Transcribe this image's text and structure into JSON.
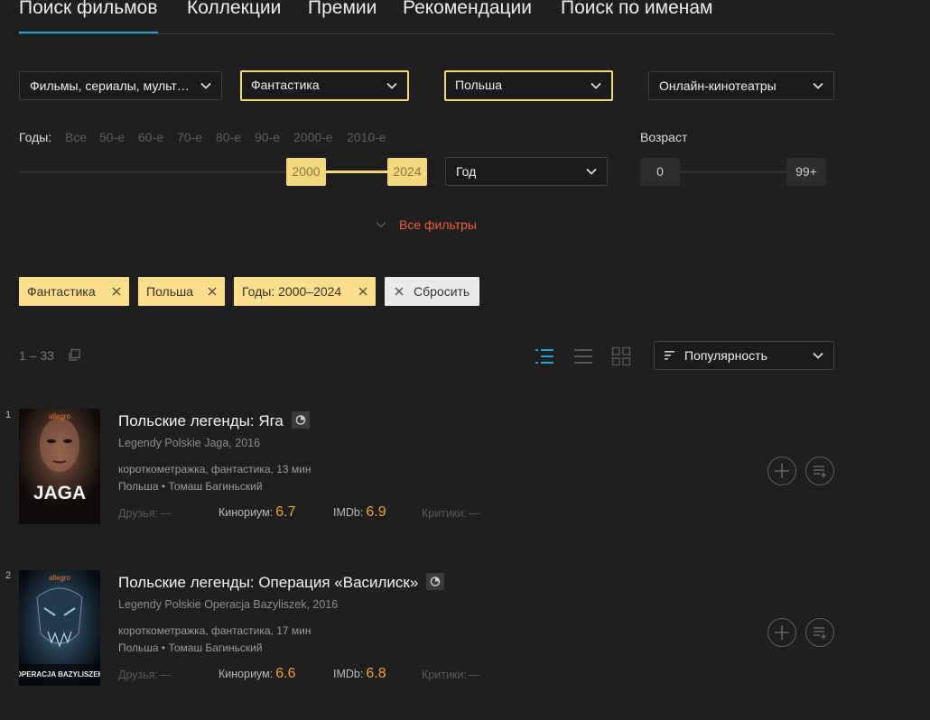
{
  "tabs": [
    {
      "label": "Поиск фильмов",
      "active": true
    },
    {
      "label": "Коллекции"
    },
    {
      "label": "Премии"
    },
    {
      "label": "Рекомендации"
    },
    {
      "label": "Поиск по именам"
    }
  ],
  "filters": {
    "type": "Фильмы, сериалы, мульт…",
    "genre": "Фантастика",
    "country": "Польша",
    "online": "Онлайн-кинотеатры",
    "sort_year": "Год"
  },
  "years": {
    "label": "Годы:",
    "presets": [
      "Все",
      "50-е",
      "60-е",
      "70-е",
      "80-е",
      "90-е",
      "2000-е",
      "2010-е"
    ],
    "from": "2000",
    "to": "2024"
  },
  "age": {
    "label": "Возраст",
    "min": "0",
    "max": "99+"
  },
  "all_filters_label": "Все фильтры",
  "chips": [
    {
      "label": "Фантастика"
    },
    {
      "label": "Польша"
    },
    {
      "label": "Годы: 2000–2024"
    }
  ],
  "reset_label": "Сбросить",
  "results": {
    "count": "1 – 33",
    "sort_label": "Популярность"
  },
  "films": [
    {
      "rank": "1",
      "title": "Польские легенды: Яга",
      "original": "Legendy Polskie Jaga, 2016",
      "genres": "короткометражка, фантастика, 13 мин",
      "country": "Польша",
      "separator": " • ",
      "director": "Томаш Багиньский",
      "poster_brand": "allegro",
      "poster_title": "JAGA",
      "friends_label": "Друзья:",
      "friends_value": "—",
      "kinorium_label": "Кинориум:",
      "kinorium": "6.7",
      "imdb_label": "IMDb:",
      "imdb": "6.9",
      "critics_label": "Критики:",
      "critics_value": "—"
    },
    {
      "rank": "2",
      "title": "Польские легенды: Операция «Василиск»",
      "original": "Legendy Polskie Operacja Bazyliszek, 2016",
      "genres": "короткометражка, фантастика, 17 мин",
      "country": "Польша",
      "separator": " • ",
      "director": "Томаш Багиньский",
      "poster_brand": "allegro",
      "poster_title": "OPERACJA BAZYLISZEK",
      "friends_label": "Друзья:",
      "friends_value": "—",
      "kinorium_label": "Кинориум:",
      "kinorium": "6.6",
      "imdb_label": "IMDb:",
      "imdb": "6.8",
      "critics_label": "Критики:",
      "critics_value": "—"
    }
  ],
  "colors": {
    "accent_tab": "#20a3d5",
    "filter_highlight": "#f2d77c",
    "rating": "#f0a227",
    "link_red": "#f05a3b"
  }
}
